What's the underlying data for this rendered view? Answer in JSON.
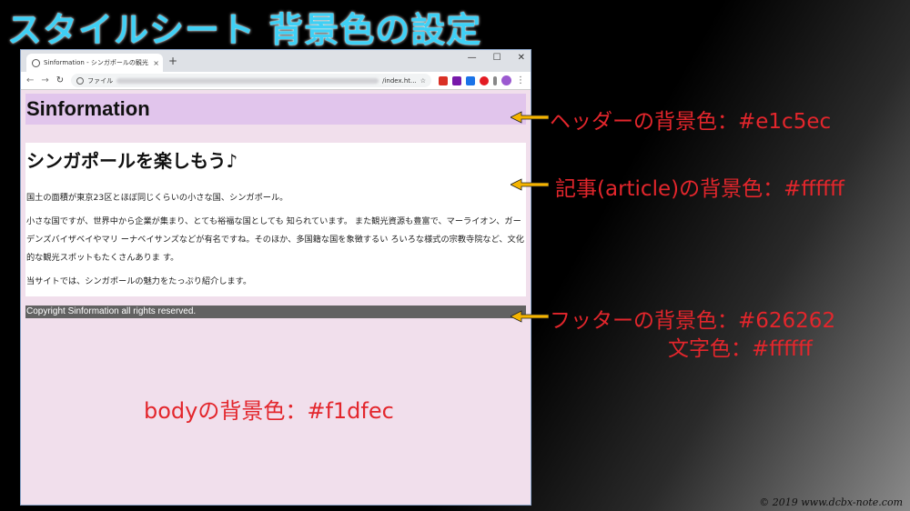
{
  "slide": {
    "title": "スタイルシート 背景色の設定",
    "watermark": "© 2019 www.dcbx-note.com"
  },
  "browser": {
    "tab_title": "Sinformation - シンガポールの観光",
    "tab_close": "×",
    "new_tab": "+",
    "window_controls": [
      "—",
      "☐",
      "✕"
    ],
    "nav_icons": [
      "←",
      "→",
      "↻"
    ],
    "address_prefix": "ファイル",
    "address_suffix": "/index.ht...",
    "star": "☆",
    "menu": "⋮"
  },
  "page": {
    "header_title": "Sinformation",
    "article_title": "シンガポールを楽しもう♪",
    "paragraphs": [
      "国土の面積が東京23区とほぼ同じくらいの小さな国、シンガポール。",
      "小さな国ですが、世界中から企業が集まり、とても裕福な国としても 知られています。 また観光資源も豊富で、マーライオン、ガーデンズバイザベイやマリ ーナベイサンズなどが有名ですね。そのほか、多国籍な国を象徴するい ろいろな様式の宗教寺院など、文化的な観光スポットもたくさんありま す。",
      "当サイトでは、シンガポールの魅力をたっぷり紹介します。"
    ],
    "footer_text": "Copyright Sinformation all rights reserved."
  },
  "annotations": {
    "header": "ヘッダーの背景色：#e1c5ec",
    "article": "記事(article)の背景色：#ffffff",
    "footer_bg": "フッターの背景色：#626262",
    "footer_color": "文字色：#ffffff",
    "body": "bodyの背景色：#f1dfec"
  },
  "colors": {
    "header_bg": "#e1c5ec",
    "article_bg": "#ffffff",
    "footer_bg": "#626262",
    "footer_text": "#ffffff",
    "body_bg": "#f1dfec",
    "annotation": "#e3262c",
    "arrow": "#f5b400",
    "title": "#3fd0f5"
  }
}
